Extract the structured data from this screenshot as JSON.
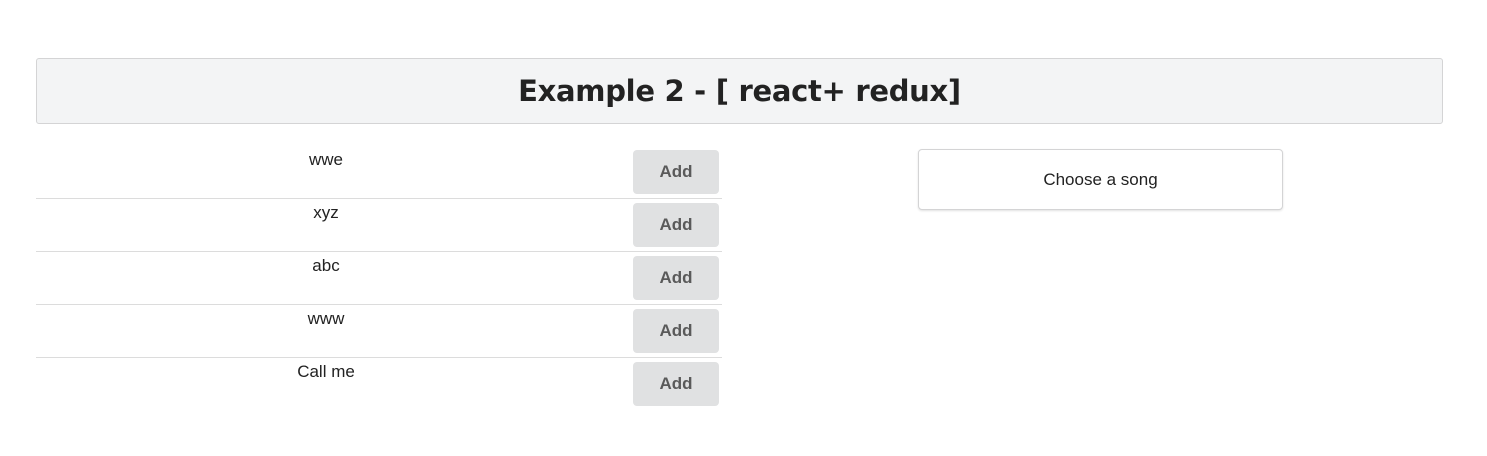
{
  "header": {
    "title": "Example 2 - [ react+ redux]"
  },
  "songs": [
    {
      "title": "wwe",
      "button_label": "Add"
    },
    {
      "title": "xyz",
      "button_label": "Add"
    },
    {
      "title": "abc",
      "button_label": "Add"
    },
    {
      "title": "www",
      "button_label": "Add"
    },
    {
      "title": "Call me",
      "button_label": "Add"
    }
  ],
  "detail": {
    "placeholder": "Choose a song"
  },
  "colors": {
    "header_bg": "#f3f4f5",
    "button_bg": "#e0e1e2",
    "button_text": "#5a5a5a",
    "divider": "#dcdcdc"
  }
}
